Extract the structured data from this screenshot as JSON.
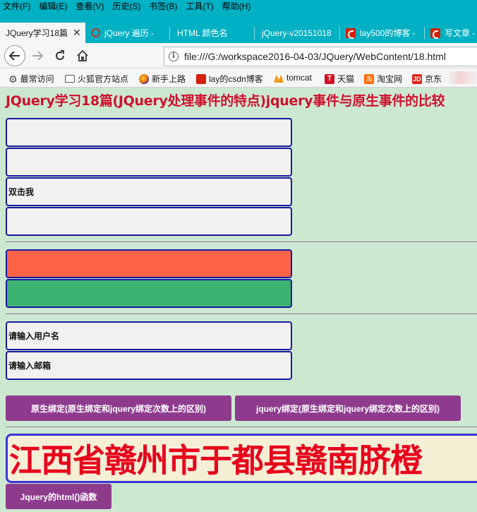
{
  "menu": [
    "文件(F)",
    "编辑(E)",
    "查看(V)",
    "历史(S)",
    "书签(B)",
    "工具(T)",
    "帮助(H)"
  ],
  "tabs": [
    {
      "label": "JQuery学习18篇",
      "icon": "none",
      "active": true
    },
    {
      "label": "jQuery 遍历 -",
      "icon": "jquery-icon"
    },
    {
      "label": "HTML 颜色名",
      "icon": "none"
    },
    {
      "label": "jQuery-v20151018",
      "icon": "none"
    },
    {
      "label": "lay500的博客 -",
      "icon": "csdn-icon"
    },
    {
      "label": "写文章 -",
      "icon": "csdn-icon"
    }
  ],
  "address": {
    "url": "file:///G:/workspace2016-04-03/JQuery/WebContent/18.html"
  },
  "bookmarks": [
    "最常访问",
    "火狐官方站点",
    "新手上路",
    "lay的csdn博客",
    "tomcat",
    "天猫",
    "淘宝网",
    "京东"
  ],
  "page": {
    "title": "JQuery学习18篇(JQuery处理事件的特点)jquery事件与原生事件的比较",
    "box1": "",
    "box2": "",
    "box3": "双击我",
    "box4": "",
    "red_box": "",
    "green_box": "",
    "username_box": "请输入用户名",
    "email_box": "请输入邮箱",
    "native_bind_button": "原生绑定(原生绑定和jquery绑定次数上的区别)",
    "jquery_bind_button": "jquery绑定(原生绑定和jquery绑定次数上的区别)",
    "orange_text": "江西省赣州市于都县赣南脐橙",
    "html_func_button": "Jquery的html()函数"
  },
  "colors": {
    "chrome": "#00b0c3",
    "page_bg": "#cde8d0",
    "title": "#d0102e",
    "box_border": "#1a1aa0",
    "red_box": "#ff6347",
    "green_box": "#3cb371",
    "button": "#8e3b8e",
    "orange_text": "#e8001c"
  }
}
